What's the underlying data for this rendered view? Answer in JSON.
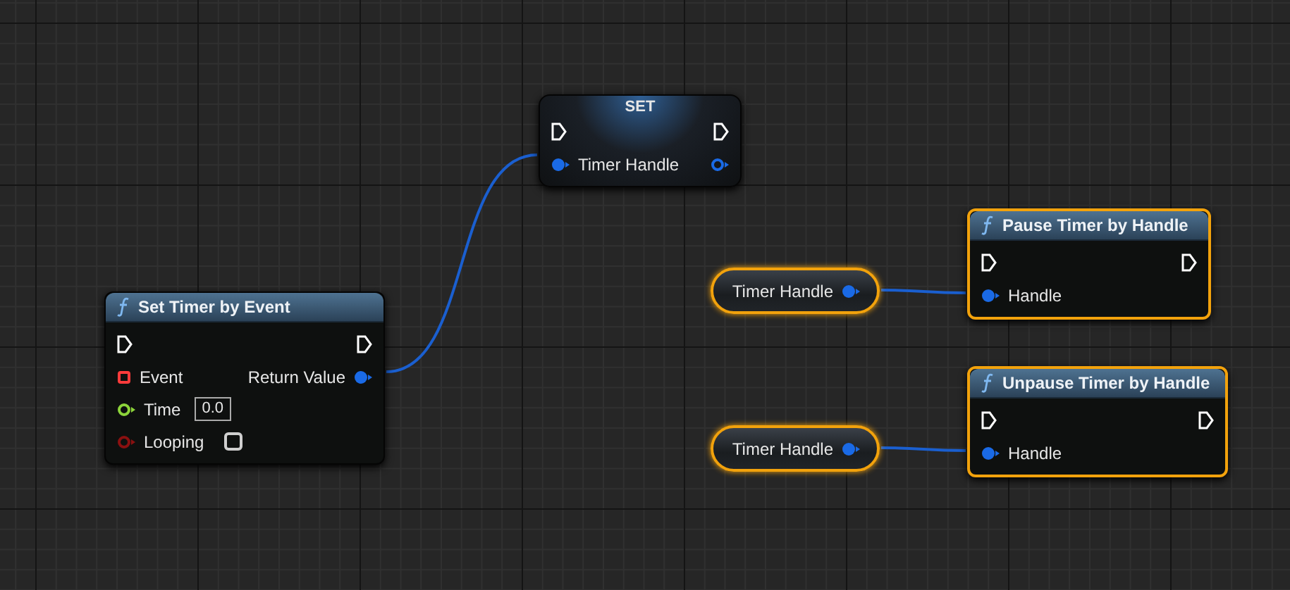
{
  "nodes": [
    {
      "kind": "function",
      "title": "Set Timer by Event",
      "selected": false,
      "rows": [
        {
          "input": {
            "kind": "exec",
            "connected": false
          },
          "output": {
            "kind": "exec",
            "connected": false
          }
        },
        {
          "input": {
            "kind": "delegate",
            "label": "Event",
            "connected": false
          },
          "output": {
            "kind": "struct",
            "label": "Return Value",
            "connected": true
          }
        },
        {
          "input": {
            "kind": "float",
            "label": "Time",
            "connected": false,
            "value": "0.0"
          }
        },
        {
          "input": {
            "kind": "bool",
            "label": "Looping",
            "connected": false,
            "checked": false
          }
        }
      ]
    },
    {
      "kind": "set",
      "title": "SET",
      "selected": false,
      "rows": [
        {
          "input": {
            "kind": "exec",
            "connected": false
          },
          "output": {
            "kind": "exec",
            "connected": false
          }
        },
        {
          "input": {
            "kind": "struct",
            "label": "Timer Handle",
            "connected": true
          },
          "output": {
            "kind": "struct",
            "connected": false
          }
        }
      ]
    },
    {
      "kind": "getter",
      "selected": true,
      "output": {
        "kind": "struct",
        "label": "Timer Handle",
        "connected": true
      }
    },
    {
      "kind": "function",
      "title": "Pause Timer by Handle",
      "selected": true,
      "rows": [
        {
          "input": {
            "kind": "exec",
            "connected": false
          },
          "output": {
            "kind": "exec",
            "connected": false
          }
        },
        {
          "input": {
            "kind": "struct",
            "label": "Handle",
            "connected": true
          }
        }
      ]
    },
    {
      "kind": "getter",
      "selected": true,
      "output": {
        "kind": "struct",
        "label": "Timer Handle",
        "connected": true
      }
    },
    {
      "kind": "function",
      "title": "Unpause Timer by Handle",
      "selected": true,
      "rows": [
        {
          "input": {
            "kind": "exec",
            "connected": false
          },
          "output": {
            "kind": "exec",
            "connected": false
          }
        },
        {
          "input": {
            "kind": "struct",
            "label": "Handle",
            "connected": true
          }
        }
      ]
    }
  ]
}
